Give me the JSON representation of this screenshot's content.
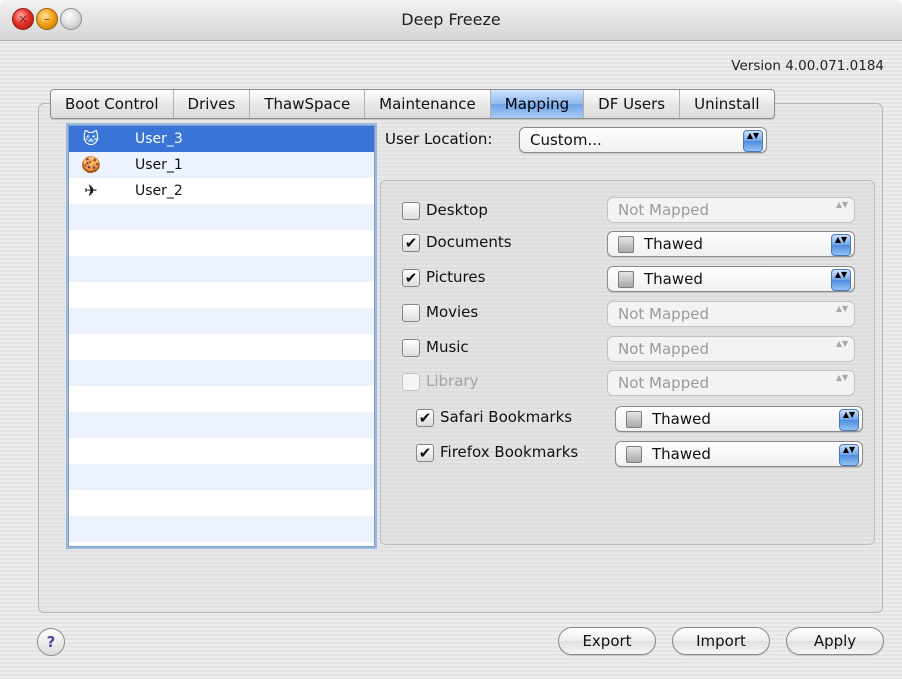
{
  "window": {
    "title": "Deep Freeze",
    "close_glyph": "×",
    "min_glyph": "–",
    "zoom_glyph": ""
  },
  "version": "Version 4.00.071.0184",
  "tabs": [
    {
      "label": "Boot Control",
      "active": false
    },
    {
      "label": "Drives",
      "active": false
    },
    {
      "label": "ThawSpace",
      "active": false
    },
    {
      "label": "Maintenance",
      "active": false
    },
    {
      "label": "Mapping",
      "active": true
    },
    {
      "label": "DF Users",
      "active": false
    },
    {
      "label": "Uninstall",
      "active": false
    }
  ],
  "users": [
    {
      "name": "User_3",
      "icon": "cat-icon",
      "glyph": "🐱",
      "selected": true
    },
    {
      "name": "User_1",
      "icon": "gingerbread-icon",
      "glyph": "🍪",
      "selected": false
    },
    {
      "name": "User_2",
      "icon": "dragonfly-icon",
      "glyph": "✈",
      "selected": false
    }
  ],
  "user_location": {
    "label": "User Location:",
    "value": "Custom..."
  },
  "mappings": [
    {
      "label": "Desktop",
      "checked": false,
      "enabled": true,
      "value": "Not Mapped"
    },
    {
      "label": "Documents",
      "checked": true,
      "enabled": true,
      "value": "Thawed"
    },
    {
      "label": "Pictures",
      "checked": true,
      "enabled": true,
      "value": "Thawed"
    },
    {
      "label": "Movies",
      "checked": false,
      "enabled": true,
      "value": "Not Mapped"
    },
    {
      "label": "Music",
      "checked": false,
      "enabled": true,
      "value": "Not Mapped"
    },
    {
      "label": "Library",
      "checked": false,
      "enabled": false,
      "value": "Not Mapped"
    },
    {
      "label": "Safari Bookmarks",
      "checked": true,
      "enabled": true,
      "value": "Thawed"
    },
    {
      "label": "Firefox Bookmarks",
      "checked": true,
      "enabled": true,
      "value": "Thawed"
    }
  ],
  "checkmark": "✔",
  "arrows_glyph": "▲▼",
  "help_label": "?",
  "buttons": {
    "export": "Export",
    "import": "Import",
    "apply": "Apply"
  }
}
